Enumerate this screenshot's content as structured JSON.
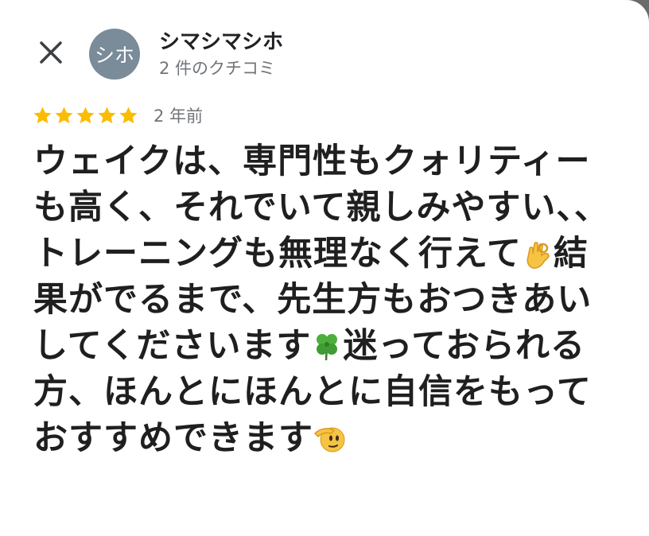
{
  "reviewer": {
    "avatar_initials": "シホ",
    "name": "シマシマシホ",
    "review_count": "2 件のクチコミ"
  },
  "review": {
    "rating": 5,
    "age": "2 年前",
    "text_parts": [
      "ウェイクは、専門性もクォリティーも高く、それでいて親しみやすい、、トレーニングも無理なく行えて",
      "結果がでるまで、先生方もおつきあいしてくださいます",
      "迷っておられる方、ほんとにほんとに自信をもっておすすめできます"
    ],
    "emojis": [
      "ok-hand-icon",
      "four-leaf-clover-icon",
      "saluting-face-icon"
    ]
  },
  "colors": {
    "star": "#fbbc04",
    "avatar_bg": "#7a8b99",
    "text": "#1f1f1f",
    "meta": "#70757a"
  }
}
